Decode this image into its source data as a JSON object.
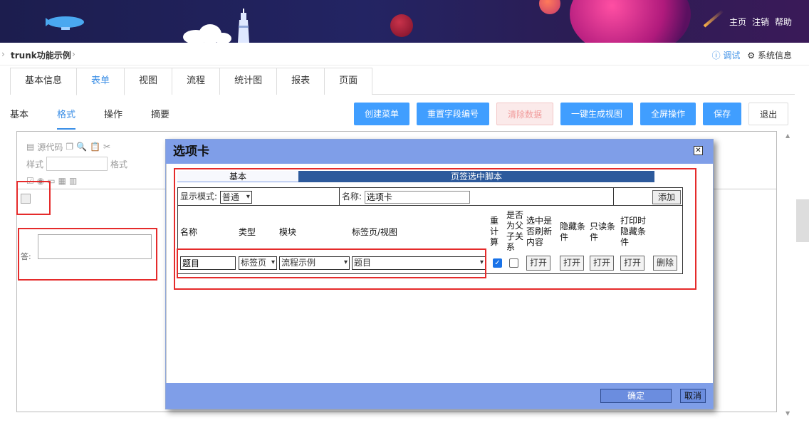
{
  "header": {
    "links": [
      "主页",
      "注销",
      "帮助"
    ]
  },
  "breadcrumb": {
    "title": "trunk功能示例",
    "debug_label": "调试",
    "sysinfo_label": "系统信息"
  },
  "main_tabs": [
    "基本信息",
    "表单",
    "视图",
    "流程",
    "统计图",
    "报表",
    "页面"
  ],
  "sub_tabs": [
    "基本",
    "格式",
    "操作",
    "摘要"
  ],
  "toolbar": [
    "创建菜单",
    "重置字段编号",
    "清除数据",
    "一键生成视图",
    "全屏操作",
    "保存",
    "退出"
  ],
  "editor": {
    "ck_source": "源代码",
    "ck_style": "样式",
    "ck_format": "格式",
    "answer_label": "答:"
  },
  "modal": {
    "title": "选项卡",
    "tab_basic": "基本",
    "tab_script": "页签选中脚本",
    "display_mode_label": "显示模式:",
    "display_mode_value": "普通",
    "name_label": "名称:",
    "name_value": "选项卡",
    "add_label": "添加",
    "headers": {
      "name": "名称",
      "type": "类型",
      "module": "模块",
      "tab_view": "标签页/视图",
      "recalc": "重计算",
      "parent_child": "是否为父子关系",
      "refresh": "选中是否刷新内容",
      "hide_cond": "隐藏条件",
      "readonly_cond": "只读条件",
      "print_hide": "打印时隐藏条件"
    },
    "row": {
      "name_value": "题目",
      "type_value": "标签页",
      "module_value": "流程示例",
      "view_value": "题目",
      "recalc_checked": true,
      "parent_child_checked": false,
      "open_label": "打开",
      "delete_label": "删除"
    },
    "ok_label": "确定",
    "cancel_label": "取消"
  }
}
